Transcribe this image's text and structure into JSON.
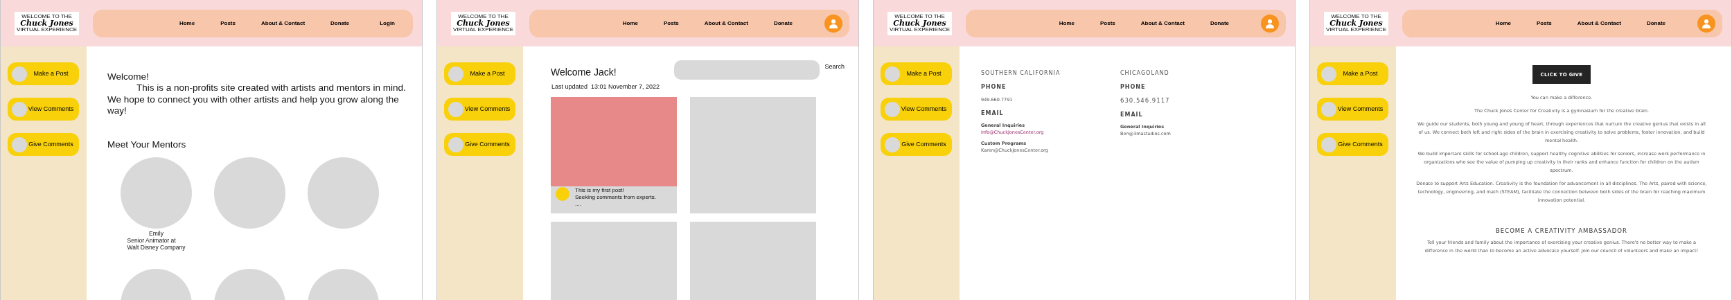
{
  "frames": [
    {
      "kind": "home",
      "logo": {
        "top": "WELCOME TO THE",
        "name": "Chuck Jones",
        "bottom": "VIRTUAL EXPERIENCE"
      },
      "nav": [
        "Home",
        "Posts",
        "About & Contact",
        "Donate"
      ],
      "nav_end": {
        "kind": "link",
        "label": "Login"
      },
      "sidebar": [
        "Make a Post",
        "View Comments",
        "Give Comments"
      ],
      "content": {
        "greeting": "Welcome!",
        "intro": "This is a non-profits site created with artists and mentors in mind. We hope to connect you with other artists and help you grow along the way!",
        "mentors_title": "Meet Your Mentors",
        "mentors": [
          {
            "kind": "captioned",
            "name": "Emily",
            "role": [
              "Senior Animator at",
              "Walt Disney Company"
            ]
          },
          {
            "kind": "blank"
          },
          {
            "kind": "blank"
          },
          {
            "kind": "blank"
          },
          {
            "kind": "blank"
          },
          {
            "kind": "blank"
          }
        ]
      }
    },
    {
      "kind": "feed",
      "logo": {
        "top": "WELCOME TO THE",
        "name": "Chuck Jones",
        "bottom": "VIRTUAL EXPERIENCE"
      },
      "nav": [
        "Home",
        "Posts",
        "About & Contact",
        "Donate"
      ],
      "nav_end": {
        "kind": "avatar"
      },
      "sidebar": [
        "Make a Post",
        "View Comments",
        "Give Comments"
      ],
      "content": {
        "title": "Welcome Jack!",
        "search_button": "Search",
        "updated": "Last updated  13:01 November 7, 2022",
        "posts": [
          {
            "kind": "image_post",
            "caption": [
              "This is my first post!",
              "Seeking comments from experts.",
              "...."
            ]
          },
          {
            "kind": "blank"
          },
          {
            "kind": "blank"
          },
          {
            "kind": "blank"
          }
        ]
      }
    },
    {
      "kind": "contact",
      "logo": {
        "top": "WELCOME TO THE",
        "name": "Chuck Jones",
        "bottom": "VIRTUAL EXPERIENCE"
      },
      "nav": [
        "Home",
        "Posts",
        "About & Contact",
        "Donate"
      ],
      "nav_end": {
        "kind": "avatar"
      },
      "sidebar": [
        "Make a Post",
        "View Comments",
        "Give Comments"
      ],
      "content": {
        "columns": [
          {
            "region": "SOUTHERN CALIFORNIA",
            "phone_label": "PHONE",
            "phone": "949.660.7791",
            "email_label": "EMAIL",
            "contacts": [
              {
                "label": "General Inquiries",
                "email": "Info@ChuckJonesCenter.org",
                "link": true
              },
              {
                "label": "Custom Programs",
                "email": "Karen@ChuckJonesCenter.org",
                "link": false
              }
            ]
          },
          {
            "region": "CHICAGOLAND",
            "phone_label": "PHONE",
            "phone": "630.546.9117",
            "email_label": "EMAIL",
            "contacts": [
              {
                "label": "General Inquiries",
                "email": "Ben@3mastudios.com",
                "link": false
              }
            ]
          }
        ]
      }
    },
    {
      "kind": "donate",
      "logo": {
        "top": "WELCOME TO THE",
        "name": "Chuck Jones",
        "bottom": "VIRTUAL EXPERIENCE"
      },
      "nav": [
        "Home",
        "Posts",
        "About & Contact",
        "Donate"
      ],
      "nav_end": {
        "kind": "avatar"
      },
      "sidebar": [
        "Make a Post",
        "View Comments",
        "Give Comments"
      ],
      "content": {
        "button": "CLICK TO GIVE",
        "paragraphs": [
          "You can make a difference.",
          "The Chuck Jones Center for Creativity is a gymnasium for the creative brain.",
          "We guide our students, both young and young of heart, through experiences that nurture the creative genius that exists in all of us. We connect both left and right sides of the brain in exercising creativity to solve problems, foster innovation, and build mental health.",
          "We build important skills for school-age children, support healthy cognitive abilities for seniors, increase work performance in organizations who see the value of pumping up creativity in their ranks and enhance function for children on the autism spectrum.",
          "Donate to support Arts Education. Creativity is the foundation for advancement in all disciplines. The Arts, paired with science, technology, engineering, and math (STEAM), facilitate the connection between both sides of the brain for reaching maximum innovation potential."
        ],
        "heading": "BECOME A CREATIVITY AMBASSADOR",
        "closing": "Tell your friends and family about the importance of exercising your creative genius. There's no better way to make a difference in the world than to become an active advocate yourself. Join our council of volunteers and make an impact!"
      }
    }
  ]
}
